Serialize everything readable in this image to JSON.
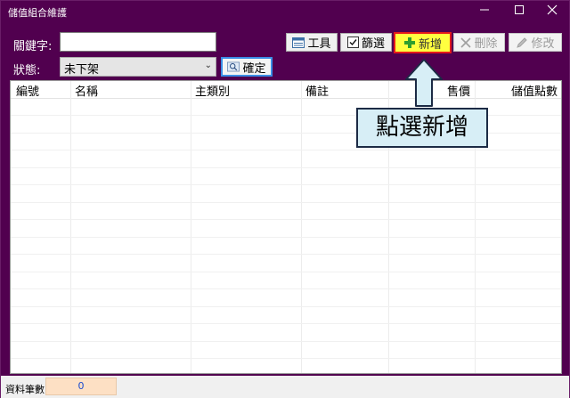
{
  "window": {
    "title": "儲值組合維護"
  },
  "form": {
    "keyword_label": "關鍵字:",
    "keyword_value": "",
    "status_label": "狀態:",
    "status_value": "未下架",
    "confirm_label": "確定"
  },
  "toolbar": {
    "tools_label": "工具",
    "filter_label": "篩選",
    "add_label": "新增",
    "delete_label": "刪除",
    "edit_label": "修改"
  },
  "grid": {
    "columns": [
      "編號",
      "名稱",
      "主類別",
      "備註",
      "售價",
      "儲值點數"
    ]
  },
  "footer": {
    "count_label": "資料筆數:",
    "count_value": "0"
  },
  "callout": {
    "text": "點選新增"
  },
  "colors": {
    "titlebar": "#51004f",
    "highlight": "#e51a1a",
    "add_button": "#ffff40",
    "callout_bg": "#d7eef6"
  }
}
